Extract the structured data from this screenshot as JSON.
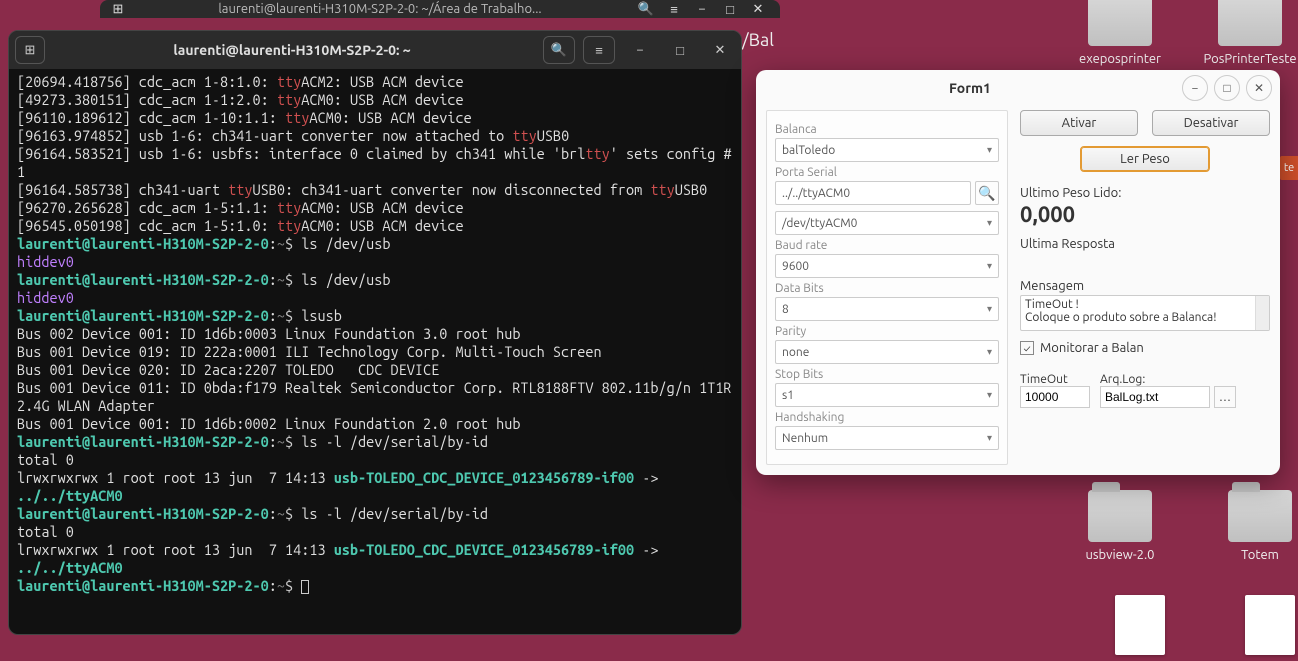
{
  "bg_terminal": {
    "title": "laurenti@laurenti-H310M-S2P-2-0: ~/Área de Trabalho..."
  },
  "bal_partial": "/Bal",
  "terminal": {
    "title": "laurenti@laurenti-H310M-S2P-2-0: ~",
    "prompt_user": "laurenti@laurenti-H310M-S2P-2-0",
    "prompt_sep": ":",
    "prompt_path": "~",
    "prompt_dollar": "$",
    "lines": {
      "l1a": "[20694.418756] cdc_acm 1-8:1.0: ",
      "l1t": "tty",
      "l1b": "ACM2: USB ACM device",
      "l2a": "[49273.380151] cdc_acm 1-1:2.0: ",
      "l2t": "tty",
      "l2b": "ACM0: USB ACM device",
      "l3a": "[96110.189612] cdc_acm 1-10:1.1: ",
      "l3t": "tty",
      "l3b": "ACM0: USB ACM device",
      "l4a": "[96163.974852] usb 1-6: ch341-uart converter now attached to ",
      "l4t": "tty",
      "l4b": "USB0",
      "l5a": "[96164.583521] usb 1-6: usbfs: interface 0 claimed by ch341 while 'brl",
      "l5t": "tty",
      "l5b": "' sets config #1",
      "l6a": "[96164.585738] ch341-uart ",
      "l6t": "tty",
      "l6b": "USB0: ch341-uart converter now disconnected from ",
      "l6t2": "tty",
      "l6c": "USB0",
      "l7a": "[96270.265628] cdc_acm 1-5:1.1: ",
      "l7t": "tty",
      "l7b": "ACM0: USB ACM device",
      "l8a": "[96545.050198] cdc_acm 1-5:1.0: ",
      "l8t": "tty",
      "l8b": "ACM0: USB ACM device",
      "cmd1": " ls /dev/usb",
      "out1": "hiddev0",
      "cmd2": " ls /dev/usb",
      "out2": "hiddev0",
      "cmd3": " lsusb",
      "usb1": "Bus 002 Device 001: ID 1d6b:0003 Linux Foundation 3.0 root hub",
      "usb2": "Bus 001 Device 019: ID 222a:0001 ILI Technology Corp. Multi-Touch Screen",
      "usb3": "Bus 001 Device 020: ID 2aca:2207 TOLEDO   CDC DEVICE",
      "usb4": "Bus 001 Device 011: ID 0bda:f179 Realtek Semiconductor Corp. RTL8188FTV 802.11b/g/n 1T1R 2.4G WLAN Adapter",
      "usb5": "Bus 001 Device 001: ID 1d6b:0002 Linux Foundation 2.0 root hub",
      "cmd4": " ls -l /dev/serial/by-id",
      "tot0": "total 0",
      "lrw": "lrwxrwxrwx 1 root root 13 jun  7 14:13 ",
      "symlink": "usb-TOLEDO_CDC_DEVICE_0123456789-if00",
      "arrow": " -> ",
      "target": "../../ttyACM0",
      "cmd5": " ls -l /dev/serial/by-id"
    }
  },
  "form": {
    "title": "Form1",
    "balanca_label": "Balanca",
    "balanca_value": "balToledo",
    "porta_label": "Porta Serial",
    "porta_value": "../../ttyACM0",
    "dev_value": "/dev/ttyACM0",
    "baud_label": "Baud rate",
    "baud_value": "9600",
    "databits_label": "Data Bits",
    "databits_value": "8",
    "parity_label": "Parity",
    "parity_value": "none",
    "stopbits_label": "Stop Bits",
    "stopbits_value": "s1",
    "handshake_label": "Handshaking",
    "handshake_value": "Nenhum",
    "ativar": "Ativar",
    "desativar": "Desativar",
    "lerpeso": "Ler Peso",
    "ultimo_label": "Ultimo Peso Lido:",
    "ultimo_val": "0,000",
    "ultresp_label": "Ultima Resposta",
    "mensagem_label": "Mensagem",
    "msg1": "TimeOut !",
    "msg2": "Coloque o produto sobre a Balanca!",
    "monitorar": "Monitorar a Balan",
    "timeout_label": "TimeOut",
    "timeout_val": "10000",
    "arqlog_label": "Arq.Log:",
    "arqlog_val": "BalLog.txt"
  },
  "desktop": {
    "icon1": "exeposprinter",
    "icon2": "PosPrinterTeste",
    "icon3": "usbview-2.0",
    "icon4": "Totem"
  },
  "edge_tab": "te"
}
